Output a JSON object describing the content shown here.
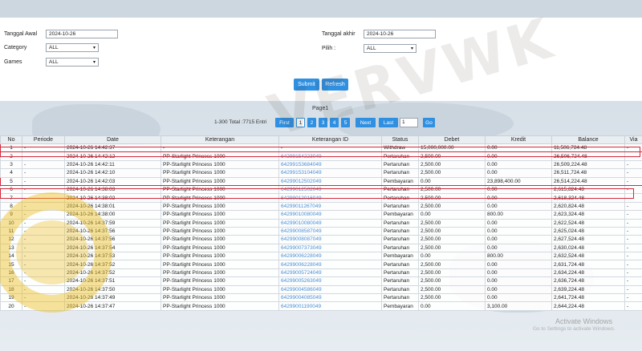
{
  "filters": {
    "tanggal_awal_label": "Tanggal Awal",
    "tanggal_awal_value": "2024-10-26",
    "category_label": "Category",
    "category_value": "ALL",
    "games_label": "Games",
    "games_value": "ALL",
    "tanggal_akhir_label": "Tanggal akhir",
    "tanggal_akhir_value": "2024-10-26",
    "pilih_label": "Pilih :",
    "pilih_value": "ALL",
    "submit_label": "Submit",
    "refresh_label": "Refresh"
  },
  "pager": {
    "page_title": "Page1",
    "total_text": "1-300 Total :7715 Entri",
    "first": "First",
    "pages": [
      "1",
      "2",
      "3",
      "4",
      "5"
    ],
    "next": "Next",
    "last": "Last",
    "go_value": "1",
    "go": "Go"
  },
  "table": {
    "headers": [
      "No",
      "Periode",
      "Date",
      "Keterangan",
      "Keterangan ID",
      "Status",
      "Debet",
      "Kredit",
      "Balance",
      "Via"
    ],
    "rows": [
      [
        "1",
        "-",
        "2024-10-26 14:42:37",
        "-",
        "-",
        "Withdraw",
        "15,000,000.00",
        "0.00",
        "11,506,724.48",
        "-"
      ],
      [
        "2",
        "-",
        "2024-10-26 14:42:12",
        "PP-Starlight Princess 1000",
        "64299154223049",
        "Pertaruhan",
        "2,500.00",
        "0.00",
        "26,506,724.48",
        "-"
      ],
      [
        "3",
        "-",
        "2024-10-26 14:42:11",
        "PP-Starlight Princess 1000",
        "64299153684049",
        "Pertaruhan",
        "2,500.00",
        "0.00",
        "26,509,224.48",
        "-"
      ],
      [
        "4",
        "-",
        "2024-10-26 14:42:10",
        "PP-Starlight Princess 1000",
        "64299153104049",
        "Pertaruhan",
        "2,500.00",
        "0.00",
        "26,511,724.48",
        "-"
      ],
      [
        "5",
        "-",
        "2024-10-26 14:42:03",
        "PP-Starlight Princess 1000",
        "64299012502049",
        "Pembayaran",
        "0.00",
        "23,898,400.00",
        "26,514,224.48",
        "-"
      ],
      [
        "6",
        "-",
        "2024-10-26 14:38:03",
        "PP-Starlight Princess 1000",
        "64299012502049",
        "Pertaruhan",
        "2,500.00",
        "0.00",
        "2,615,824.48",
        "-"
      ],
      [
        "7",
        "-",
        "2024-10-26 14:38:02",
        "PP-Starlight Princess 1000",
        "64299012016049",
        "Pertaruhan",
        "2,500.00",
        "0.00",
        "2,618,324.48",
        "-"
      ],
      [
        "8",
        "-",
        "2024-10-26 14:38:01",
        "PP-Starlight Princess 1000",
        "64299011267049",
        "Pertaruhan",
        "2,500.00",
        "0.00",
        "2,620,824.48",
        "-"
      ],
      [
        "9",
        "-",
        "2024-10-26 14:38:00",
        "PP-Starlight Princess 1000",
        "64299010080049",
        "Pembayaran",
        "0.00",
        "800.00",
        "2,623,324.48",
        "-"
      ],
      [
        "10",
        "-",
        "2024-10-26 14:37:59",
        "PP-Starlight Princess 1000",
        "64299010080049",
        "Pertaruhan",
        "2,500.00",
        "0.00",
        "2,622,524.48",
        "-"
      ],
      [
        "11",
        "-",
        "2024-10-26 14:37:56",
        "PP-Starlight Princess 1000",
        "64299008587049",
        "Pertaruhan",
        "2,500.00",
        "0.00",
        "2,625,024.48",
        "-"
      ],
      [
        "12",
        "-",
        "2024-10-26 14:37:56",
        "PP-Starlight Princess 1000",
        "64299008087049",
        "Pertaruhan",
        "2,500.00",
        "0.00",
        "2,627,524.48",
        "-"
      ],
      [
        "13",
        "-",
        "2024-10-26 14:37:54",
        "PP-Starlight Princess 1000",
        "64299007373049",
        "Pertaruhan",
        "2,500.00",
        "0.00",
        "2,630,024.48",
        "-"
      ],
      [
        "14",
        "-",
        "2024-10-26 14:37:53",
        "PP-Starlight Princess 1000",
        "64299006228049",
        "Pembayaran",
        "0.00",
        "800.00",
        "2,632,524.48",
        "-"
      ],
      [
        "15",
        "-",
        "2024-10-26 14:37:52",
        "PP-Starlight Princess 1000",
        "64299006228049",
        "Pertaruhan",
        "2,500.00",
        "0.00",
        "2,631,724.48",
        "-"
      ],
      [
        "16",
        "-",
        "2024-10-26 14:37:52",
        "PP-Starlight Princess 1000",
        "64299005724049",
        "Pertaruhan",
        "2,500.00",
        "0.00",
        "2,634,224.48",
        "-"
      ],
      [
        "17",
        "-",
        "2024-10-26 14:37:51",
        "PP-Starlight Princess 1000",
        "64299005263049",
        "Pertaruhan",
        "2,500.00",
        "0.00",
        "2,636,724.48",
        "-"
      ],
      [
        "18",
        "-",
        "2024-10-26 14:37:50",
        "PP-Starlight Princess 1000",
        "64299004586049",
        "Pertaruhan",
        "2,500.00",
        "0.00",
        "2,639,224.48",
        "-"
      ],
      [
        "19",
        "-",
        "2024-10-26 14:37:49",
        "PP-Starlight Princess 1000",
        "64299004085049",
        "Pertaruhan",
        "2,500.00",
        "0.00",
        "2,641,724.48",
        "-"
      ],
      [
        "20",
        "-",
        "2024-10-26 14:37:47",
        "PP-Starlight Princess 1000",
        "64299001190049",
        "Pembayaran",
        "0.00",
        "3,100.00",
        "2,644,224.48",
        "-"
      ]
    ]
  },
  "overlay": {
    "activate_line1": "Activate Windows",
    "activate_line2": "Go to Settings to activate Windows."
  },
  "colors": {
    "accent": "#2f8fe0",
    "highlight": "#d2283a",
    "link": "#4a8fd6"
  }
}
